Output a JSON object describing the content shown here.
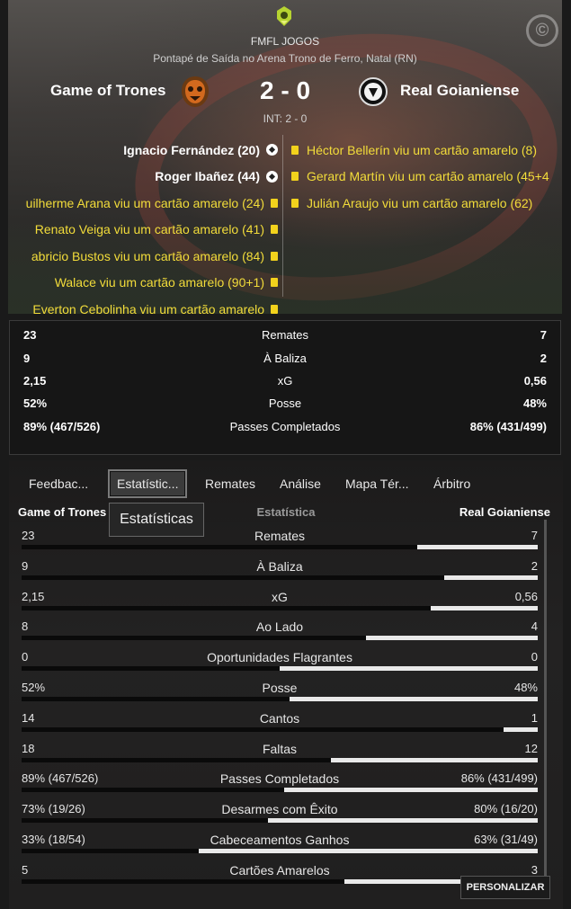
{
  "header": {
    "competition": "FMFL JOGOS",
    "venue": "Pontapé de Saída no Arena Trono de Ferro, Natal (RN)",
    "home_team": "Game of Trones",
    "away_team": "Real Goianiense",
    "score": "2 - 0",
    "interval": "INT: 2 - 0",
    "copyright_glyph": "©"
  },
  "events": {
    "home": [
      {
        "text": "Ignacio Fernández (20)",
        "type": "goal"
      },
      {
        "text": "Roger Ibañez (44)",
        "type": "goal"
      },
      {
        "text": "uilherme Arana viu um cartão amarelo (24)",
        "type": "yellow"
      },
      {
        "text": "Renato Veiga viu um cartão amarelo (41)",
        "type": "yellow"
      },
      {
        "text": "abricio Bustos viu um cartão amarelo (84)",
        "type": "yellow"
      },
      {
        "text": "Walace viu um cartão amarelo (90+1)",
        "type": "yellow"
      },
      {
        "text": "Everton Cebolinha viu um cartão amarelo",
        "type": "yellow"
      }
    ],
    "away": [
      {
        "text": "Héctor Bellerín viu um cartão amarelo (8)",
        "type": "yellow"
      },
      {
        "text": "Gerard Martín viu um cartão amarelo (45+4",
        "type": "yellow"
      },
      {
        "text": "Julián Araujo viu um cartão amarelo (62)",
        "type": "yellow"
      }
    ]
  },
  "summary": [
    {
      "home": "23",
      "label": "Remates",
      "away": "7"
    },
    {
      "home": "9",
      "label": "À Baliza",
      "away": "2"
    },
    {
      "home": "2,15",
      "label": "xG",
      "away": "0,56"
    },
    {
      "home": "52%",
      "label": "Posse",
      "away": "48%"
    },
    {
      "home": "89% (467/526)",
      "label": "Passes Completados",
      "away": "86% (431/499)"
    }
  ],
  "tabs": [
    "Feedbac...",
    "Estatístic...",
    "Remates",
    "Análise",
    "Mapa Tér...",
    "Árbitro"
  ],
  "active_tab": "Estatístic...",
  "tooltip": "Estatísticas",
  "columns": {
    "home": "Game of Trones",
    "middle": "Estatística",
    "away": "Real Goianiense"
  },
  "stats": [
    {
      "home": "23",
      "label": "Remates",
      "away": "7",
      "home_share": 0.767
    },
    {
      "home": "9",
      "label": "À Baliza",
      "away": "2",
      "home_share": 0.818
    },
    {
      "home": "2,15",
      "label": "xG",
      "away": "0,56",
      "home_share": 0.793
    },
    {
      "home": "8",
      "label": "Ao Lado",
      "away": "4",
      "home_share": 0.667
    },
    {
      "home": "0",
      "label": "Oportunidades Flagrantes",
      "away": "0",
      "home_share": 0.5
    },
    {
      "home": "52%",
      "label": "Posse",
      "away": "48%",
      "home_share": 0.52
    },
    {
      "home": "14",
      "label": "Cantos",
      "away": "1",
      "home_share": 0.933
    },
    {
      "home": "18",
      "label": "Faltas",
      "away": "12",
      "home_share": 0.6
    },
    {
      "home": "89% (467/526)",
      "label": "Passes Completados",
      "away": "86% (431/499)",
      "home_share": 0.509
    },
    {
      "home": "73% (19/26)",
      "label": "Desarmes com Êxito",
      "away": "80% (16/20)",
      "home_share": 0.477
    },
    {
      "home": "33% (18/54)",
      "label": "Cabeceamentos Ganhos",
      "away": "63% (31/49)",
      "home_share": 0.344
    },
    {
      "home": "5",
      "label": "Cartões Amarelos",
      "away": "3",
      "home_share": 0.625
    }
  ],
  "customize_button": "PERSONALIZAR",
  "colors": {
    "yellow_card": "#f2d21c",
    "event_text": "#f2dc3a",
    "bar_away": "#e9e9e9"
  }
}
